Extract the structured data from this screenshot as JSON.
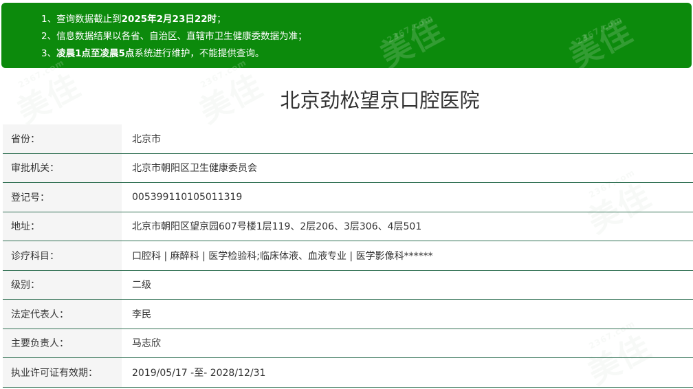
{
  "notice": {
    "lines": [
      {
        "num": "1、",
        "text": "查询数据截止到",
        "bold": "2025年2月23日22时",
        "tail": "；"
      },
      {
        "num": "2、",
        "text": "信息数据结果以各省、自治区、直辖市卫生健康委数据为准；",
        "bold": "",
        "tail": ""
      },
      {
        "num": "3、",
        "text": "",
        "bold": "凌晨1点至凌晨5点",
        "tail": "系统进行维护，不能提供查询。"
      }
    ]
  },
  "watermark": {
    "text": "美佳",
    "sub": "2367.com"
  },
  "hospital": {
    "name": "北京劲松望京口腔医院"
  },
  "info": {
    "rows": [
      {
        "label": "省份：",
        "value": "北京市"
      },
      {
        "label": "审批机关：",
        "value": "北京市朝阳区卫生健康委员会"
      },
      {
        "label": "登记号：",
        "value": "005399110105011319"
      },
      {
        "label": "地址：",
        "value": "北京市朝阳区望京园607号楼1层119、2层206、3层306、4层501"
      },
      {
        "label": "诊疗科目：",
        "value": "口腔科 | 麻醉科 | 医学检验科;临床体液、血液专业 | 医学影像科******"
      },
      {
        "label": "级别：",
        "value": "二级"
      },
      {
        "label": "法定代表人：",
        "value": "李民"
      },
      {
        "label": "主要负责人：",
        "value": "马志欣"
      },
      {
        "label": "执业许可证有效期：",
        "value": "2019/05/17 -至- 2028/12/31"
      }
    ]
  },
  "colors": {
    "banner": "#0c8a0c",
    "row_border": "#2f6f52",
    "label_bg": "#f5f5f5"
  }
}
